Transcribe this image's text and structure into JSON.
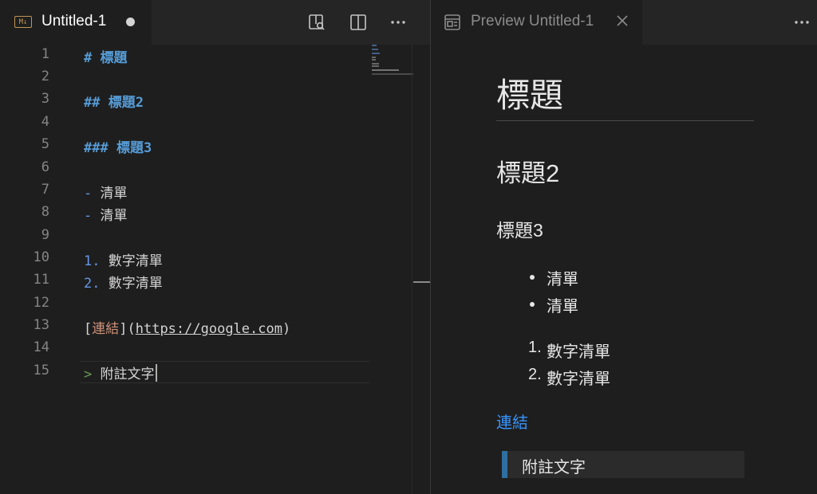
{
  "editor": {
    "tab": {
      "icon_label": "M↓",
      "title": "Untitled-1"
    },
    "line_numbers": [
      "1",
      "2",
      "3",
      "4",
      "5",
      "6",
      "7",
      "8",
      "9",
      "10",
      "11",
      "12",
      "13",
      "14",
      "15"
    ],
    "lines": {
      "l1_marker": "# ",
      "l1_text": "標題",
      "l3_marker": "## ",
      "l3_text": "標題2",
      "l5_marker": "### ",
      "l5_text": "標題3",
      "l7_marker": "-",
      "l7_text": " 清單",
      "l8_marker": "-",
      "l8_text": " 清單",
      "l10_marker": "1.",
      "l10_text": " 數字清單",
      "l11_marker": "2.",
      "l11_text": " 數字清單",
      "l13_open": "[",
      "l13_link_text": "連結",
      "l13_mid": "](",
      "l13_url": "https://google.com",
      "l13_close": ")",
      "l15_marker": ">",
      "l15_text": " 附註文字"
    }
  },
  "preview": {
    "tab_title": "Preview Untitled-1",
    "h1": "標題",
    "h2": "標題2",
    "h3": "標題3",
    "bullets": [
      "清單",
      "清單"
    ],
    "numbered": [
      {
        "num": "1.",
        "text": "數字清單"
      },
      {
        "num": "2.",
        "text": "數字清單"
      }
    ],
    "link": "連結",
    "blockquote": "附註文字"
  },
  "colors": {
    "background": "#1e1e1e",
    "heading_markdown": "#569cd6",
    "link_color": "#3794ff",
    "quote_bar": "#2f6ea0"
  }
}
